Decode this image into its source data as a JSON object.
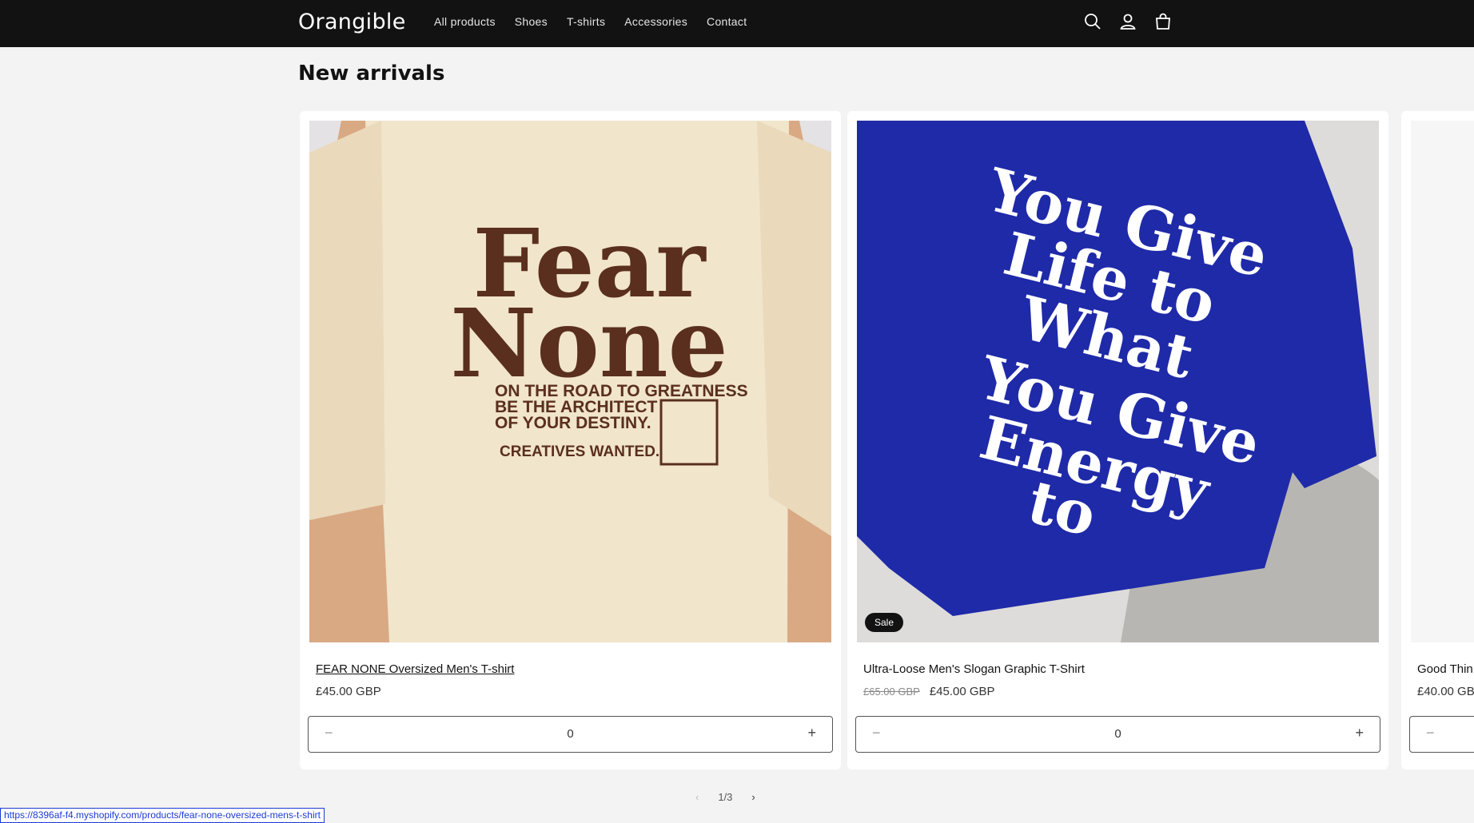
{
  "header": {
    "logo": "Orangible",
    "nav": [
      "All products",
      "Shoes",
      "T-shirts",
      "Accessories",
      "Contact"
    ],
    "icons": [
      "search-icon",
      "account-icon",
      "cart-icon"
    ],
    "background": "#121212"
  },
  "section": {
    "title": "New arrivals"
  },
  "products": [
    {
      "title": "FEAR NONE Oversized Men's T-shirt",
      "price": "£45.00 GBP",
      "old_price": "",
      "quantity": "0",
      "badge": "",
      "image_text": [
        "Fear",
        "None",
        "ON THE ROAD TO GREATNESS",
        "BE THE ARCHITECT",
        "OF YOUR DESTINY.",
        "CREATIVES WANTED."
      ]
    },
    {
      "title": "Ultra-Loose Men's Slogan Graphic T-Shirt",
      "price": "£45.00 GBP",
      "old_price": "£65.00 GBP",
      "quantity": "0",
      "badge": "Sale",
      "image_text": [
        "You Give",
        "Life to",
        "What",
        "You Give",
        "Energy",
        "to"
      ]
    },
    {
      "title": "Good Thin",
      "price": "£40.00 GB",
      "old_price": "",
      "quantity": "",
      "badge": ""
    }
  ],
  "pager": {
    "label": "1/3"
  },
  "status_url": "https://8396af-f4.myshopify.com/products/fear-none-oversized-mens-t-shirt",
  "colors": {
    "tee_cream": "#f1e5cc",
    "print_brown": "#5a2f1e",
    "tee_blue": "#1f2aa8",
    "accent_dark": "#121212"
  }
}
